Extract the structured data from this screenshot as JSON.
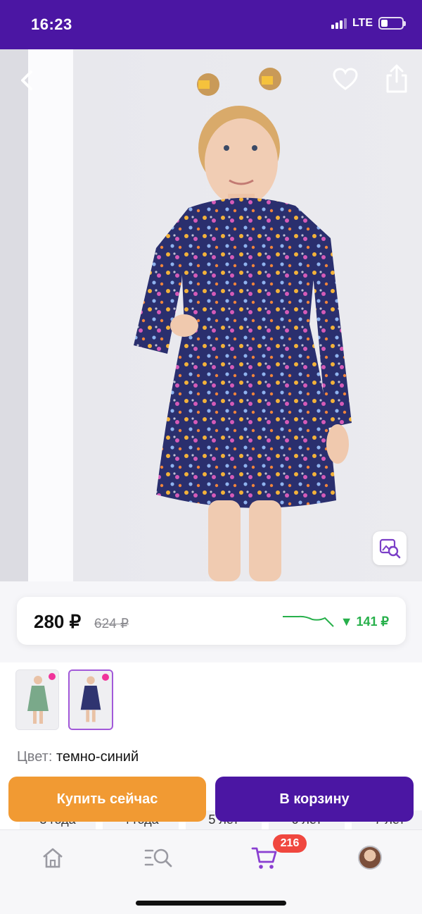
{
  "status_bar": {
    "time": "16:23",
    "network": "LTE",
    "signal_bars": 3,
    "battery_level": 0.3
  },
  "product": {
    "price_current": "280 ₽",
    "price_old": "624 ₽",
    "price_drop": "▼ 141 ₽",
    "color_label": "Цвет:",
    "color_value": "темно-синий"
  },
  "actions": {
    "buy_now": "Купить сейчас",
    "add_to_cart": "В корзину"
  },
  "sizes": [
    "3 года",
    "4 года",
    "5 лет",
    "6 лет",
    "7 лет"
  ],
  "nav": {
    "cart_count": "216"
  },
  "colors": {
    "brand_purple": "#4b16a3",
    "buy_orange": "#f19a33",
    "price_drop_green": "#27b04b",
    "badge_red": "#f0473f"
  },
  "icons": [
    "back-icon",
    "heart-icon",
    "share-icon",
    "visual-search-icon",
    "home-icon",
    "catalog-search-icon",
    "cart-icon",
    "avatar"
  ]
}
